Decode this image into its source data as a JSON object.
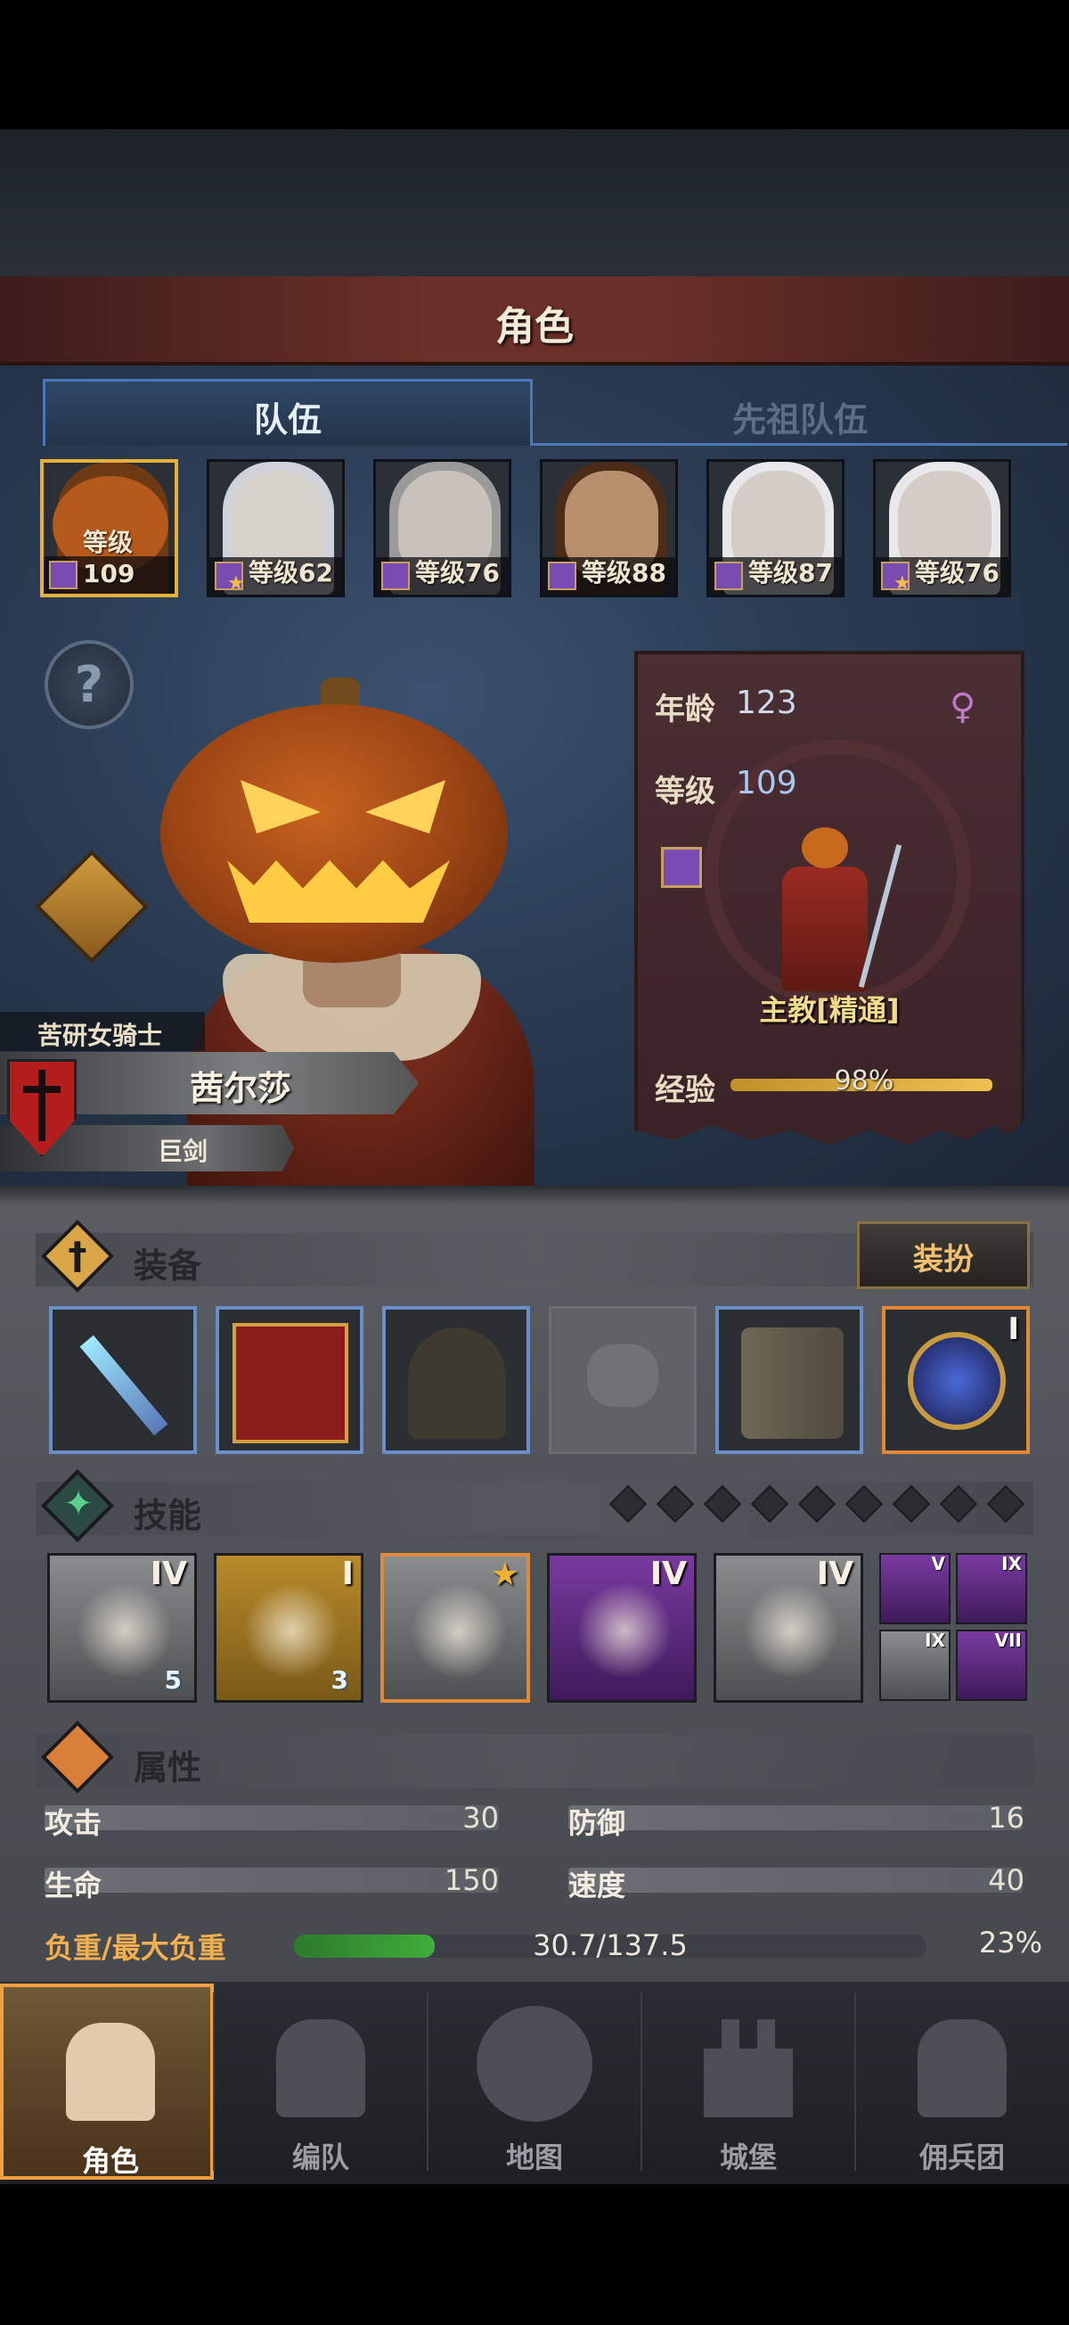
{
  "header": {
    "title": "角色"
  },
  "tabs": [
    {
      "label": "队伍",
      "active": true
    },
    {
      "label": "先祖队伍",
      "active": false
    }
  ],
  "roster": [
    {
      "level_text": "等级109",
      "selected": true,
      "star": false,
      "kind": "pumpkin"
    },
    {
      "level_text": "等级62",
      "selected": false,
      "star": true,
      "kind": "elf"
    },
    {
      "level_text": "等级76",
      "selected": false,
      "star": false,
      "kind": "grey"
    },
    {
      "level_text": "等级88",
      "selected": false,
      "star": false,
      "kind": "dwarf"
    },
    {
      "level_text": "等级87",
      "selected": false,
      "star": false,
      "kind": "silver"
    },
    {
      "level_text": "等级76",
      "selected": false,
      "star": true,
      "kind": "silver"
    }
  ],
  "hero": {
    "title": "苦研女骑士",
    "name": "茜尔莎",
    "weapon": "巨剑"
  },
  "info": {
    "age_label": "年龄",
    "age": "123",
    "level_label": "等级",
    "level": "109",
    "class_name": "主教[精通]",
    "exp_label": "经验",
    "exp_text": "98%",
    "exp_fraction": 0.98,
    "gender_icon": "female-symbol-icon"
  },
  "equipment": {
    "label": "装备",
    "dress_button": "装扮",
    "slots": [
      {
        "name": "sword-icon",
        "tier": ""
      },
      {
        "name": "book-icon",
        "tier": ""
      },
      {
        "name": "hood-icon",
        "tier": ""
      },
      {
        "name": "empty-gloves-icon",
        "tier": ""
      },
      {
        "name": "boots-icon",
        "tier": ""
      },
      {
        "name": "orb-icon",
        "tier": "I"
      }
    ]
  },
  "skills": {
    "label": "技能",
    "pip_count": 9,
    "items": [
      {
        "tier": "IV",
        "gem": "5",
        "style": "grey"
      },
      {
        "tier": "I",
        "gem": "3",
        "style": "gold"
      },
      {
        "tier": "★",
        "gem": "",
        "style": "grey"
      },
      {
        "tier": "IV",
        "gem": "",
        "style": "purple"
      },
      {
        "tier": "IV",
        "gem": "",
        "style": "grey"
      }
    ],
    "mini": [
      {
        "tier": "V",
        "style": "purple"
      },
      {
        "tier": "IX",
        "style": "purple"
      },
      {
        "tier": "IX",
        "style": "grey"
      },
      {
        "tier": "VII",
        "style": "purple"
      }
    ]
  },
  "attributes": {
    "label": "属性",
    "attack_label": "攻击",
    "attack": "30",
    "defense_label": "防御",
    "defense": "16",
    "hp_label": "生命",
    "hp": "150",
    "speed_label": "速度",
    "speed": "40",
    "load_label": "负重/最大负重",
    "load_text": "30.7/137.5",
    "load_pct": "23%",
    "load_fraction": 0.223
  },
  "nav": [
    {
      "label": "角色",
      "active": true
    },
    {
      "label": "编队",
      "active": false
    },
    {
      "label": "地图",
      "active": false
    },
    {
      "label": "城堡",
      "active": false
    },
    {
      "label": "佣兵团",
      "active": false
    }
  ]
}
